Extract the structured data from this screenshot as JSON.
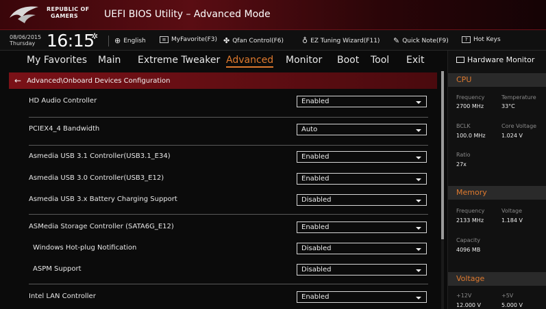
{
  "app": {
    "brand_line1": "REPUBLIC OF",
    "brand_line2": "GAMERS",
    "title": "UEFI BIOS Utility – Advanced Mode"
  },
  "toolbar": {
    "date": "08/06/2015",
    "day": "Thursday",
    "time": "16:15",
    "language": "English",
    "myfavorite": "MyFavorite(F3)",
    "qfan": "Qfan Control(F6)",
    "ez_tuning": "EZ Tuning Wizard(F11)",
    "quick_note": "Quick Note(F9)",
    "hot_keys": "Hot Keys",
    "hot_keys_icon": "?"
  },
  "menu": {
    "items": [
      "My Favorites",
      "Main",
      "Extreme Tweaker",
      "Advanced",
      "Monitor",
      "Boot",
      "Tool",
      "Exit"
    ],
    "active": "Advanced"
  },
  "breadcrumb": "Advanced\\Onboard Devices Configuration",
  "settings": [
    {
      "label": "HD Audio Controller",
      "value": "Enabled"
    },
    {
      "label": "PCIEX4_4 Bandwidth",
      "value": "Auto"
    },
    {
      "label": "Asmedia USB 3.1 Controller(USB3.1_E34)",
      "value": "Enabled"
    },
    {
      "label": "Asmedia USB 3.0 Controller(USB3_E12)",
      "value": "Enabled"
    },
    {
      "label": "Asmedia USB 3.x Battery Charging Support",
      "value": "Disabled"
    },
    {
      "label": "ASMedia Storage Controller (SATA6G_E12)",
      "value": "Enabled"
    },
    {
      "label": "Windows Hot-plug Notification",
      "value": "Disabled"
    },
    {
      "label": "ASPM Support",
      "value": "Disabled"
    },
    {
      "label": "Intel LAN Controller",
      "value": "Enabled"
    }
  ],
  "hw_monitor": {
    "title": "Hardware Monitor",
    "cpu": {
      "header": "CPU",
      "frequency_label": "Frequency",
      "frequency": "2700 MHz",
      "temperature_label": "Temperature",
      "temperature": "33°C",
      "bclk_label": "BCLK",
      "bclk": "100.0 MHz",
      "core_voltage_label": "Core Voltage",
      "core_voltage": "1.024 V",
      "ratio_label": "Ratio",
      "ratio": "27x"
    },
    "memory": {
      "header": "Memory",
      "frequency_label": "Frequency",
      "frequency": "2133 MHz",
      "voltage_label": "Voltage",
      "voltage": "1.184 V",
      "capacity_label": "Capacity",
      "capacity": "4096 MB"
    },
    "voltage": {
      "header": "Voltage",
      "v12_label": "+12V",
      "v12": "12.000 V",
      "v5_label": "+5V",
      "v5": "5.000 V"
    }
  },
  "colors": {
    "accent": "#e07a2e",
    "title_red": "#5a0d13",
    "breadcrumb_red": "#7a1117"
  }
}
